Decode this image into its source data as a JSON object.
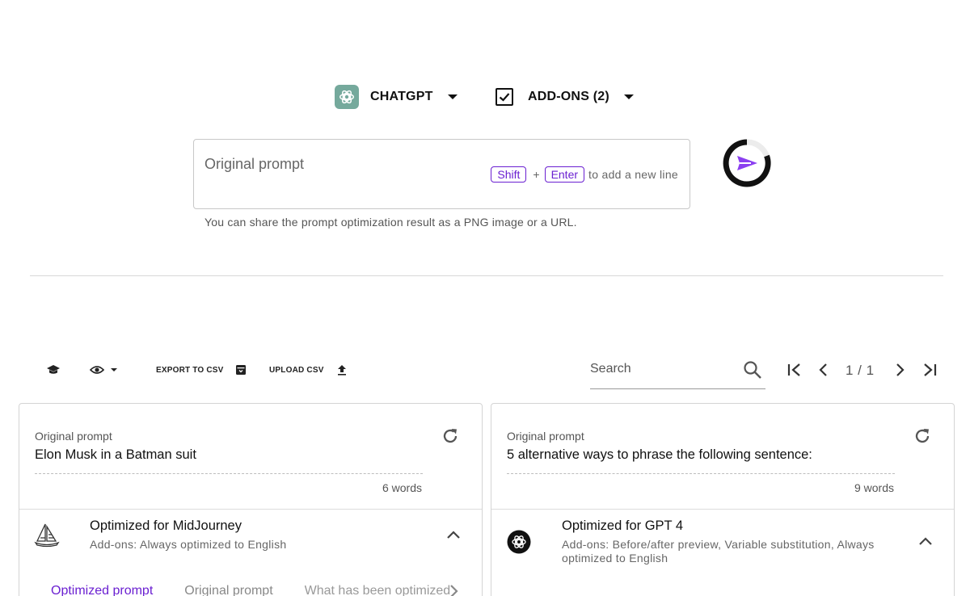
{
  "model_selector": {
    "label": "CHATGPT",
    "icon": "chatgpt-logo-icon"
  },
  "addons_selector": {
    "label": "ADD-ONS (2)",
    "checked": true
  },
  "prompt": {
    "placeholder": "Original prompt",
    "hint_key1": "Shift",
    "hint_plus": "+",
    "hint_key2": "Enter",
    "hint_text": "to add a new line",
    "share_note": "You can share the prompt optimization result as a PNG image or a URL."
  },
  "toolbar": {
    "export_label": "EXPORT TO CSV",
    "upload_label": "UPLOAD CSV",
    "search_placeholder": "Search",
    "page_text": "1 / 1"
  },
  "cards": [
    {
      "original_label": "Original prompt",
      "original_text": "Elon Musk in a Batman suit",
      "word_count": "6 words",
      "optimized_title": "Optimized for MidJourney",
      "addons_text": "Add-ons: Always optimized to English",
      "model_icon": "sailboat-icon",
      "tabs": [
        "Optimized prompt",
        "Original prompt",
        "What has been optimized"
      ]
    },
    {
      "original_label": "Original prompt",
      "original_text": "5 alternative ways to phrase the following sentence:",
      "word_count": "9 words",
      "optimized_title": "Optimized for GPT 4",
      "addons_text": "Add-ons: Before/after preview, Variable substitution, Always optimized to English",
      "model_icon": "openai-icon"
    }
  ],
  "colors": {
    "accent": "#6a1fd1",
    "chatgpt_green": "#75a99c"
  }
}
